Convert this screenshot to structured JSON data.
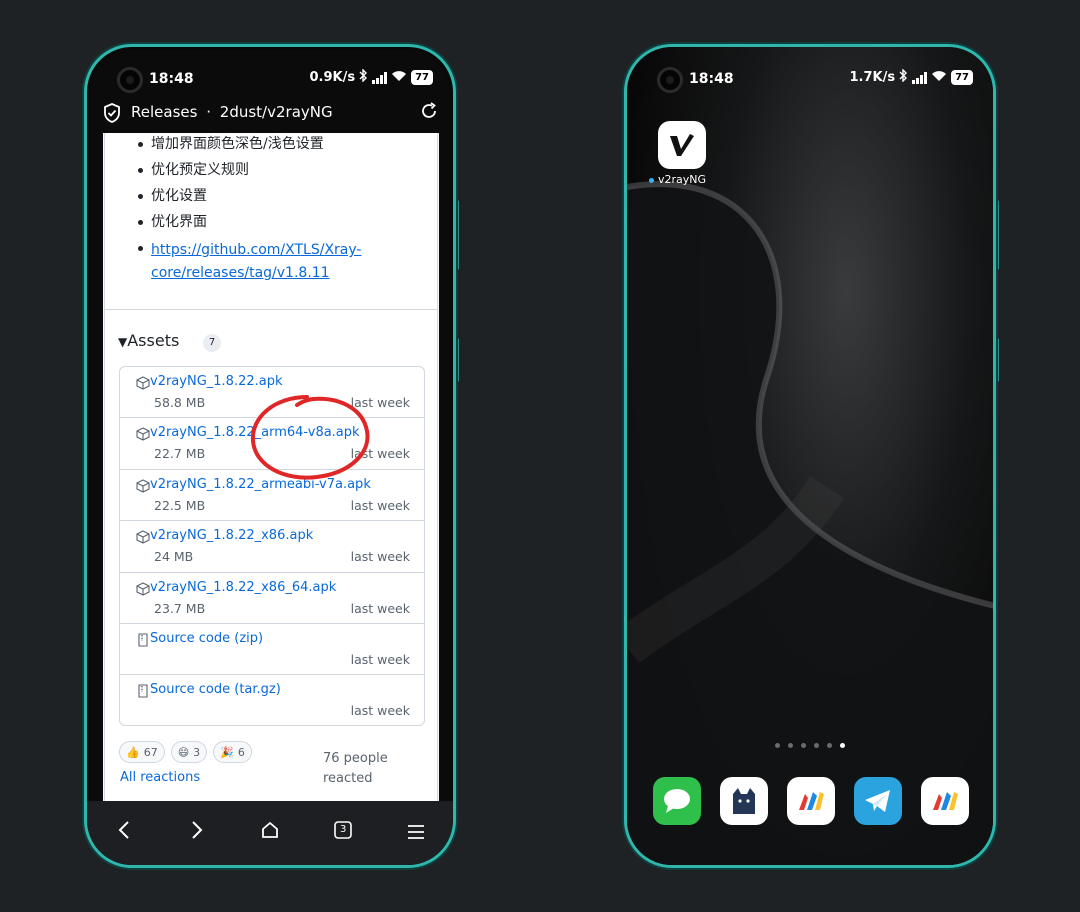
{
  "left_phone": {
    "status": {
      "time": "18:48",
      "speed": "0.9K/s",
      "battery": "77"
    },
    "url_bar": {
      "title": "Releases",
      "separator": "·",
      "repo": "2dust/v2rayNG"
    },
    "release_notes": [
      {
        "text": "增加界面颜色深色/浅色设置",
        "link": false
      },
      {
        "text": "优化预定义规则",
        "link": false
      },
      {
        "text": "优化设置",
        "link": false
      },
      {
        "text": "优化界面",
        "link": false
      },
      {
        "text": "https://github.com/XTLS/Xray-core/releases/tag/v1.8.11",
        "link": true
      }
    ],
    "link_lines": [
      "https://github.com/XTLS/Xray-",
      "core/releases/tag/v1.8.11"
    ],
    "assets": {
      "heading": "Assets",
      "count": "7",
      "items": [
        {
          "name": "v2rayNG_1.8.22.apk",
          "size": "58.8 MB",
          "date": "last week",
          "icon": "package-icon"
        },
        {
          "name": "v2rayNG_1.8.22_arm64-v8a.apk",
          "size": "22.7 MB",
          "date": "last week",
          "icon": "package-icon"
        },
        {
          "name": "v2rayNG_1.8.22_armeabi-v7a.apk",
          "size": "22.5 MB",
          "date": "last week",
          "icon": "package-icon"
        },
        {
          "name": "v2rayNG_1.8.22_x86.apk",
          "size": "24 MB",
          "date": "last week",
          "icon": "package-icon"
        },
        {
          "name": "v2rayNG_1.8.22_x86_64.apk",
          "size": "23.7 MB",
          "date": "last week",
          "icon": "package-icon"
        },
        {
          "name": "Source code (zip)",
          "size": "",
          "date": "last week",
          "icon": "file-zip-icon"
        },
        {
          "name": "Source code (tar.gz)",
          "size": "",
          "date": "last week",
          "icon": "file-zip-icon"
        }
      ]
    },
    "reactions": [
      {
        "emoji": "👍",
        "count": "67"
      },
      {
        "emoji": "😄",
        "count": "3"
      },
      {
        "emoji": "🎉",
        "count": "6"
      }
    ],
    "all_reactions": "All reactions",
    "people_reacted": "76 people reacted",
    "tab_count": "3",
    "accent": "#2fb7ad",
    "link_color": "#0969da"
  },
  "right_phone": {
    "status": {
      "time": "18:48",
      "speed": "1.7K/s",
      "battery": "77"
    },
    "home_app": {
      "label": "v2rayNG",
      "icon": "v2rayng-app-icon"
    },
    "page_dots": 6,
    "active_dot": 5,
    "dock": [
      {
        "icon": "messages-app-icon",
        "color": "#2fc04c"
      },
      {
        "icon": "cat-app-icon",
        "color": "#ffffff"
      },
      {
        "icon": "v2ray-red-app-icon",
        "color": "#ffffff"
      },
      {
        "icon": "telegram-app-icon",
        "color": "#2aa3df"
      },
      {
        "icon": "v2ray-red-app-icon",
        "color": "#ffffff"
      }
    ]
  }
}
